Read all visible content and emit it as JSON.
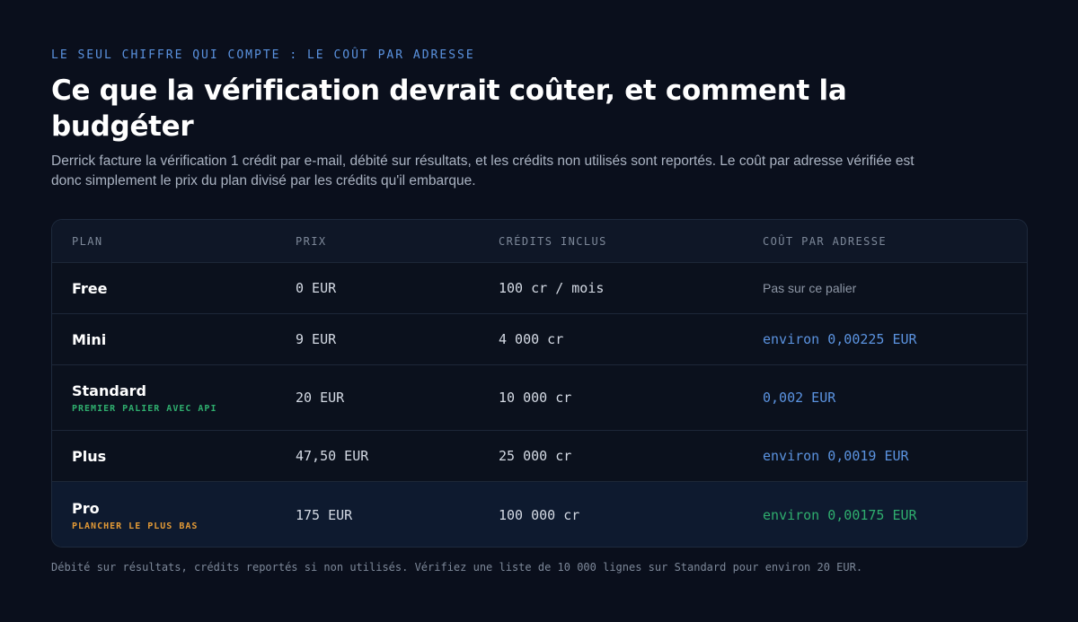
{
  "eyebrow": "LE SEUL CHIFFRE QUI COMPTE : LE COÛT PAR ADRESSE",
  "title": "Ce que la vérification devrait coûter, et comment la budgéter",
  "subtitle": "Derrick facture la vérification 1 crédit par e-mail, débité sur résultats, et les crédits non utilisés sont reportés. Le coût par adresse vérifiée est donc simplement le prix du plan divisé par les crédits qu'il embarque.",
  "table": {
    "headers": [
      "PLAN",
      "PRIX",
      "CRÉDITS INCLUS",
      "COÛT PAR ADRESSE"
    ],
    "rows": [
      {
        "plan": "Free",
        "tag": "",
        "price": "0 EUR",
        "credits": "100 cr / mois",
        "cost": "Pas sur ce palier"
      },
      {
        "plan": "Mini",
        "tag": "",
        "price": "9 EUR",
        "credits": "4 000 cr",
        "cost": "environ 0,00225 EUR"
      },
      {
        "plan": "Standard",
        "tag": "PREMIER PALIER AVEC API",
        "price": "20 EUR",
        "credits": "10 000 cr",
        "cost": "0,002 EUR"
      },
      {
        "plan": "Plus",
        "tag": "",
        "price": "47,50 EUR",
        "credits": "25 000 cr",
        "cost": "environ 0,0019 EUR"
      },
      {
        "plan": "Pro",
        "tag": "PLANCHER LE PLUS BAS",
        "price": "175 EUR",
        "credits": "100 000 cr",
        "cost": "environ 0,00175 EUR"
      }
    ]
  },
  "footer": "Débité sur résultats, crédits reportés si non utilisés. Vérifiez une liste de 10 000 lignes sur Standard pour environ 20 EUR.",
  "colors": {
    "background": "#0a0f1c",
    "accent_blue": "#5b93e0",
    "accent_green": "#2fae6e",
    "accent_orange": "#e39a36"
  }
}
